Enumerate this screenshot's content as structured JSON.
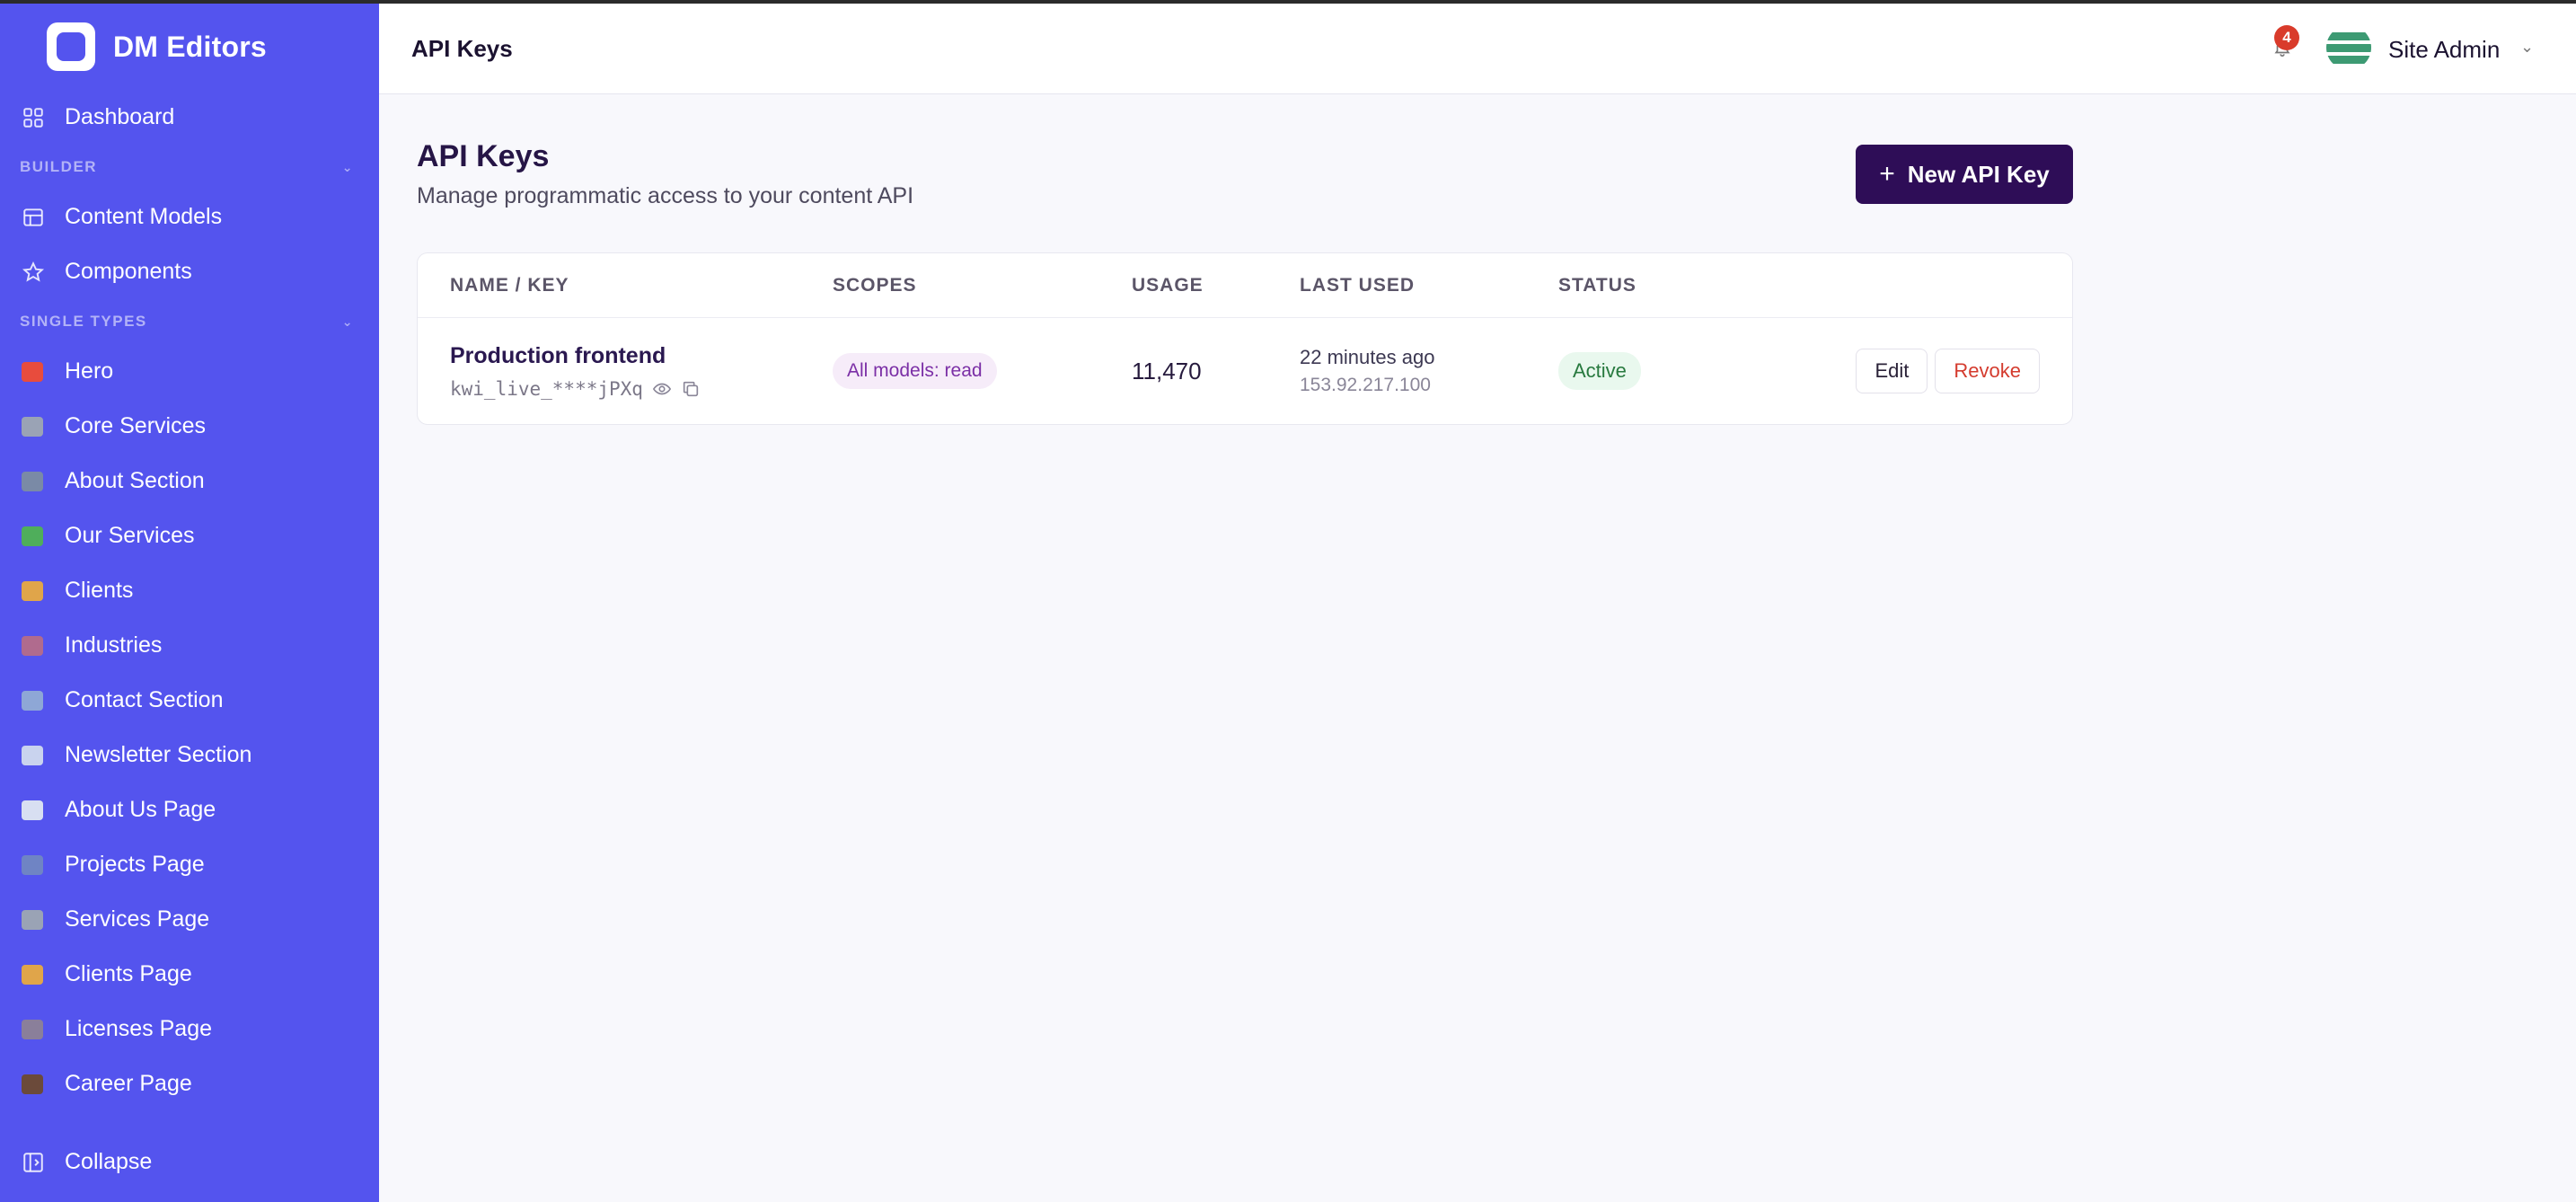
{
  "brand": {
    "name": "DM Editors"
  },
  "sidebar": {
    "dashboard": "Dashboard",
    "builder_heading": "BUILDER",
    "builder_items": [
      {
        "label": "Content Models",
        "icon": "table-icon"
      },
      {
        "label": "Components",
        "icon": "star-icon"
      }
    ],
    "single_types_heading": "SINGLE TYPES",
    "single_items": [
      {
        "label": "Hero",
        "icon": "target-icon",
        "color": "#e84c3d"
      },
      {
        "label": "Core Services",
        "icon": "tools-icon",
        "color": "#9aa3b5"
      },
      {
        "label": "About Section",
        "icon": "building-icon",
        "color": "#7a8aa6"
      },
      {
        "label": "Our Services",
        "icon": "puzzle-icon",
        "color": "#4fae5b"
      },
      {
        "label": "Clients",
        "icon": "handshake-icon",
        "color": "#e0a54a"
      },
      {
        "label": "Industries",
        "icon": "factory-icon",
        "color": "#b06b8e"
      },
      {
        "label": "Contact Section",
        "icon": "inbox-icon",
        "color": "#8ea7d6"
      },
      {
        "label": "Newsletter Section",
        "icon": "envelope-icon",
        "color": "#c9d3ee"
      },
      {
        "label": "About Us Page",
        "icon": "book-icon",
        "color": "#d8dff2"
      },
      {
        "label": "Projects Page",
        "icon": "folder-icon",
        "color": "#6f84c4"
      },
      {
        "label": "Services Page",
        "icon": "tools-icon",
        "color": "#9aa3b5"
      },
      {
        "label": "Clients Page",
        "icon": "handshake-icon",
        "color": "#e0a54a"
      },
      {
        "label": "Licenses Page",
        "icon": "document-icon",
        "color": "#8a7f9a"
      },
      {
        "label": "Career Page",
        "icon": "briefcase-icon",
        "color": "#6b4a3a"
      }
    ],
    "collapse": "Collapse"
  },
  "topbar": {
    "title": "API Keys",
    "notification_count": "4",
    "user_name": "Site Admin"
  },
  "page": {
    "title": "API Keys",
    "subtitle": "Manage programmatic access to your content API",
    "new_button": "New API Key"
  },
  "table": {
    "headers": {
      "name": "NAME / KEY",
      "scopes": "SCOPES",
      "usage": "USAGE",
      "last_used": "LAST USED",
      "status": "STATUS"
    },
    "rows": [
      {
        "name": "Production frontend",
        "key": "kwi_live_****jPXq",
        "scope": "All models: read",
        "usage": "11,470",
        "last_used": "22 minutes ago",
        "ip": "153.92.217.100",
        "status": "Active",
        "edit": "Edit",
        "revoke": "Revoke"
      }
    ]
  }
}
